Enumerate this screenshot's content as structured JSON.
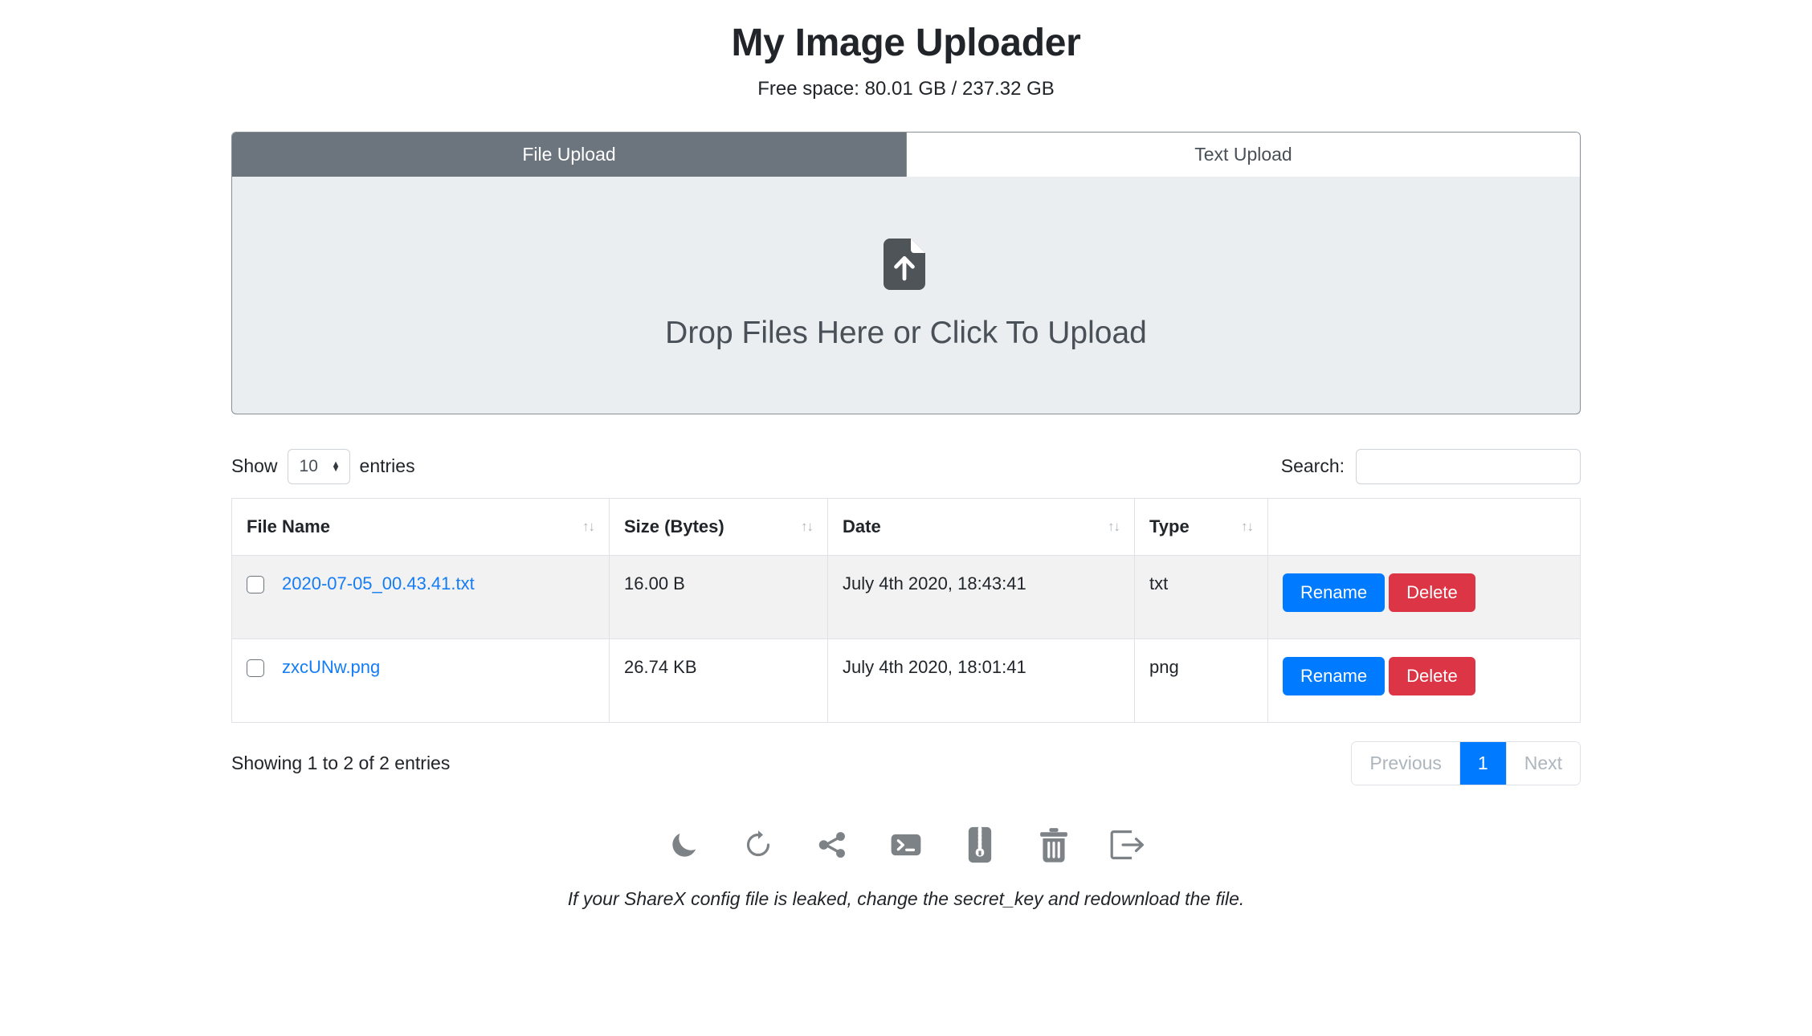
{
  "header": {
    "title": "My Image Uploader",
    "free_space": "Free space: 80.01 GB / 237.32 GB"
  },
  "tabs": [
    {
      "label": "File Upload",
      "active": true
    },
    {
      "label": "Text Upload",
      "active": false
    }
  ],
  "dropzone": {
    "text": "Drop Files Here or Click To Upload",
    "icon": "file-upload-icon",
    "background": "#eaeef1",
    "border_color": "#868e96"
  },
  "controls": {
    "show_label": "Show",
    "entries_label": "entries",
    "page_length_value": "10",
    "page_length_options": [
      "10",
      "25",
      "50",
      "100"
    ],
    "search_label": "Search:",
    "search_value": "",
    "search_placeholder": ""
  },
  "table": {
    "columns": [
      {
        "label": "File Name",
        "sortable": true
      },
      {
        "label": "Size (Bytes)",
        "sortable": true
      },
      {
        "label": "Date",
        "sortable": true
      },
      {
        "label": "Type",
        "sortable": true
      },
      {
        "label": "",
        "sortable": false
      }
    ],
    "sort_icon": "↑↓",
    "rows": [
      {
        "checked": false,
        "file_name": "2020-07-05_00.43.41.txt",
        "size": "16.00 B",
        "date": "July 4th 2020, 18:43:41",
        "type": "txt",
        "rename_label": "Rename",
        "delete_label": "Delete"
      },
      {
        "checked": false,
        "file_name": "zxcUNw.png",
        "size": "26.74 KB",
        "date": "July 4th 2020, 18:01:41",
        "type": "png",
        "rename_label": "Rename",
        "delete_label": "Delete"
      }
    ]
  },
  "footer": {
    "showing_info": "Showing 1 to 2 of 2 entries",
    "pagination": {
      "previous_label": "Previous",
      "pages": [
        "1"
      ],
      "active_page": "1",
      "next_label": "Next"
    },
    "icons": [
      "moon-icon",
      "refresh-icon",
      "share-icon",
      "terminal-icon",
      "zip-archive-icon",
      "trash-icon",
      "logout-icon"
    ],
    "note": "If your ShareX config file is leaked, change the secret_key and redownload the file."
  },
  "colors": {
    "accent_blue": "#007bff",
    "link_blue": "#147df5",
    "danger_red": "#dc3545",
    "tab_active_bg": "#6c757d",
    "icon_gray": "#7d8287"
  }
}
